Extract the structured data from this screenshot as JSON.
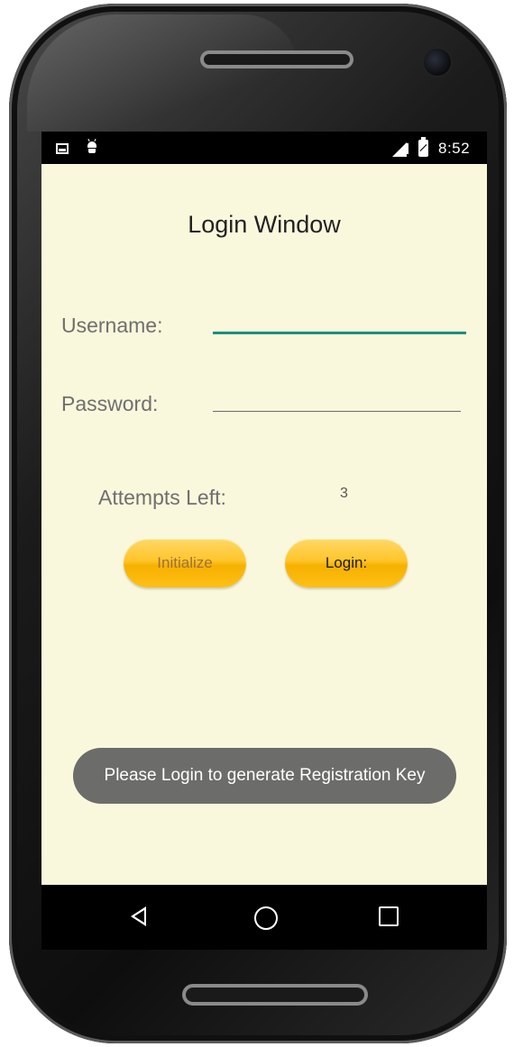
{
  "status_bar": {
    "time": "8:52",
    "icons": [
      "image-notification-icon",
      "android-debug-icon",
      "signal-icon",
      "battery-charging-icon"
    ]
  },
  "app": {
    "title": "Login Window",
    "username_label": "Username:",
    "username_value": "",
    "password_label": "Password:",
    "password_value": "",
    "attempts_label": "Attempts Left:",
    "attempts_value": "3",
    "initialize_button": "Initialize",
    "login_button": "Login:"
  },
  "toast": {
    "message": "Please Login to generate Registration Key"
  },
  "nav_bar": {
    "icons": [
      "back-icon",
      "home-icon",
      "recents-icon"
    ]
  },
  "colors": {
    "screen_background": "#faf8dc",
    "accent_underline": "#16907c",
    "button_yellow": "#ffc52a",
    "toast_background": "#6c6c6a"
  }
}
